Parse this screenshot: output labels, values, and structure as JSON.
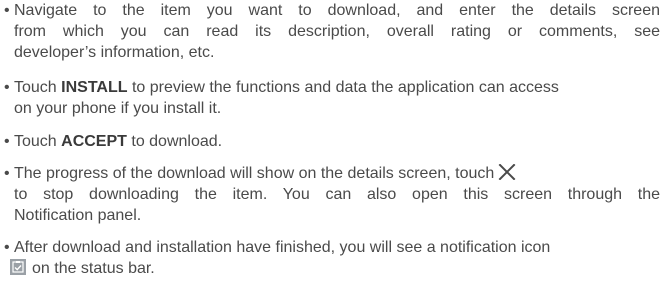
{
  "bullet_char": "•",
  "items": [
    {
      "lines": [
        "Navigate to the item you want to download, and enter the details screen",
        "from which you can read its description, overall rating or comments, see",
        "developer’s information, etc."
      ]
    },
    {
      "prefix": "Touch ",
      "bold": "INSTALL",
      "suffix": " to preview the functions and data the application can access",
      "line2": "on your phone if you install it."
    },
    {
      "prefix": "Touch ",
      "bold": "ACCEPT",
      "suffix": " to download."
    },
    {
      "line1": "The progress of the download will show on the details screen, touch",
      "line2": "to stop downloading the item. You can also open this screen through the",
      "line3": "Notification panel.",
      "icon": "close-x-icon"
    },
    {
      "line1": "After download and installation have finished, you will see a notification icon",
      "line2": "on the status bar.",
      "icon": "download-complete-notification-icon",
      "icon_color": "#9aa0a6"
    }
  ]
}
